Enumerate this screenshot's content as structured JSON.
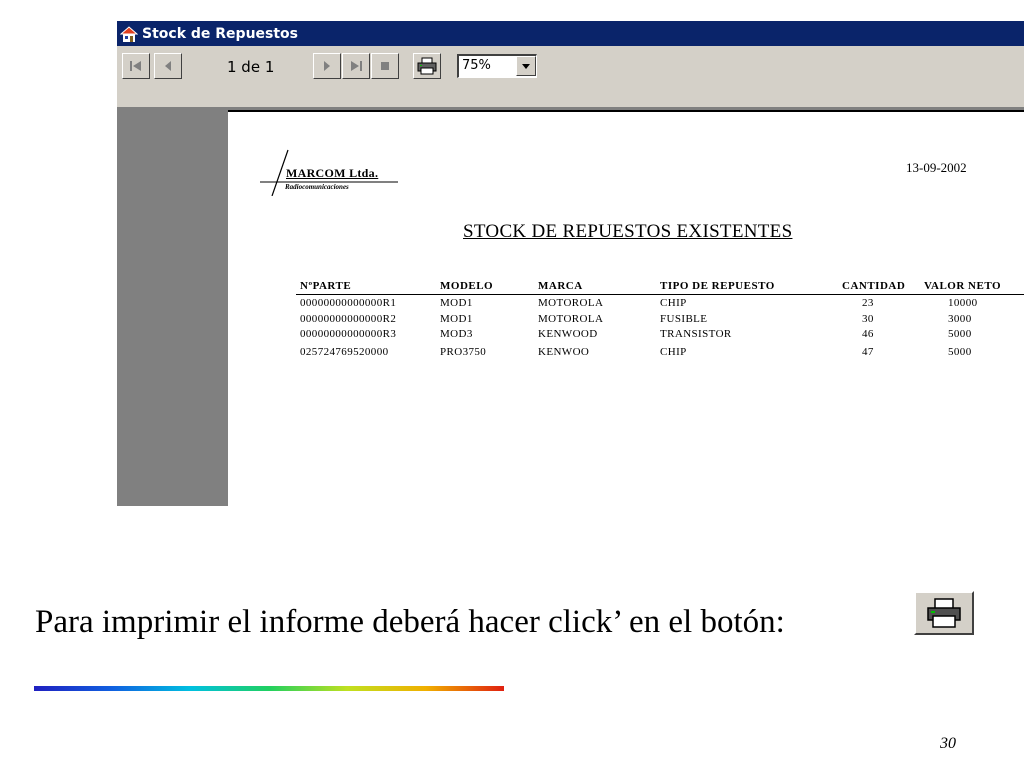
{
  "window": {
    "title": "Stock de Repuestos",
    "toolbar": {
      "page_indicator": "1 de 1",
      "zoom_value": "75%",
      "buttons": [
        "first-page",
        "previous-page",
        "next-page",
        "last-page",
        "stop",
        "print"
      ]
    }
  },
  "report": {
    "logo_name": "MARCOM Ltda.",
    "logo_subtitle": "Radiocomunicaciones",
    "date": "13-09-2002",
    "title": "STOCK DE REPUESTOS EXISTENTES",
    "columns": [
      "NºPARTE",
      "MODELO",
      "MARCA",
      "TIPO DE REPUESTO",
      "CANTIDAD",
      "VALOR NETO"
    ],
    "rows": [
      [
        "00000000000000R1",
        "MOD1",
        "MOTOROLA",
        "CHIP",
        "23",
        "10000"
      ],
      [
        "00000000000000R2",
        "MOD1",
        "MOTOROLA",
        "FUSIBLE",
        "30",
        "3000"
      ],
      [
        "00000000000000R3",
        "MOD3",
        "KENWOOD",
        "TRANSISTOR",
        "46",
        "5000"
      ],
      [
        "025724769520000",
        "PRO3750",
        "KENWOO",
        "CHIP",
        "47",
        "5000"
      ]
    ]
  },
  "caption": {
    "text": "Para imprimir el informe deberá hacer click’ en el botón:",
    "button_icon": "printer-icon"
  },
  "slide_number": "30",
  "colors": {
    "titlebar": "#0a246a",
    "toolbar": "#d4d0c8",
    "workspace": "#808080"
  }
}
